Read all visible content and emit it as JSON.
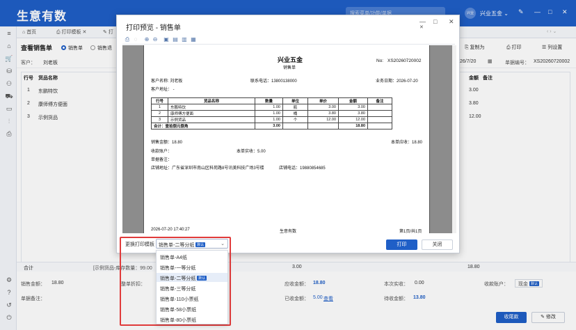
{
  "app": {
    "logo": "生意有数",
    "search_placeholder": "搜索菜单/功能/单据",
    "user_avatar": "兴业",
    "user_name": "兴业五金",
    "icons": [
      "palette-icon",
      "minimize-icon",
      "maximize-icon",
      "close-icon"
    ]
  },
  "tabs": [
    {
      "label": "首页"
    },
    {
      "label": "打印模板"
    },
    {
      "label": "打"
    }
  ],
  "page": {
    "title": "查看销售单",
    "radio1": "销售单",
    "radio2": "销售退",
    "copy_label": "复制为",
    "print_label": "打印",
    "cols_label": "列设置",
    "customer_label": "客户：",
    "customer_value": "刘老板",
    "date_value": "26/7/20",
    "bill_no_label": "单据编号：",
    "bill_no_value": "XS20260720002",
    "col_no": "行号",
    "col_name": "货品名称",
    "col_amount": "金额",
    "col_remark": "备注",
    "rows": [
      {
        "no": "1",
        "name": "东鹏特饮",
        "amount": "3.00"
      },
      {
        "no": "2",
        "name": "康师傅方便面",
        "amount": "3.80"
      },
      {
        "no": "3",
        "name": "示例货品",
        "amount": "12.00"
      }
    ],
    "sum_label": "合计",
    "sum_stock": "[示例货品-库存数量：99.00",
    "sum_qty": "3.00",
    "sum_amount": "18.80",
    "sales_amount_label": "销售金额：",
    "sales_amount_value": "18.80",
    "discount_label": "整单折扣：",
    "receivable_label": "应收金额：",
    "receivable_value": "18.80",
    "actual_label": "本次实收：",
    "actual_value": "0.00",
    "account_label": "收款账户：",
    "account_value": "现金",
    "default_tag": "默认",
    "remark_label": "单据备注：",
    "received_label": "已收金额：",
    "received_value": "5.00",
    "view_link": "查看",
    "pending_label": "待收金额：",
    "pending_value": "13.80",
    "collect_btn": "收尾款",
    "edit_btn": "修改"
  },
  "dialog": {
    "title": "打印预览 - 销售单",
    "paper": {
      "company": "兴业五金",
      "doc_type": "销售单",
      "no_label": "No:",
      "no_value": "XS20260720002",
      "customer": "客户名称: 刘老板",
      "phone": "联系电话：13800138000",
      "biz_date": "业务日期：2026-07-20",
      "address": "客户地址： -",
      "table_headers": [
        "行号",
        "货品名称",
        "数量",
        "单位",
        "单价",
        "金额",
        "备注"
      ],
      "table_rows": [
        [
          "1",
          "东鹏特饮",
          "1.00",
          "瓶",
          "3.00",
          "3.00",
          ""
        ],
        [
          "2",
          "康师傅方便面",
          "1.00",
          "桶",
          "3.80",
          "3.80",
          ""
        ],
        [
          "3",
          "示例货品",
          "1.00",
          "个",
          "12.00",
          "12.00",
          ""
        ]
      ],
      "total_label": "合计：壹拾捌元捌角",
      "total_qty": "3.00",
      "total_amount": "18.80",
      "sales_amount": "销售金额：18.80",
      "current_receivable": "本单应收：18.80",
      "account": "收款账户：",
      "actual": "本单实收：5.00",
      "remark": "单据备注：",
      "store_addr": "店铺地址：广东省深圳市南山区科苑路8号讯美科技广场3号楼",
      "store_phone": "店铺电话：19880854685",
      "print_time": "2026-07-20 17:40:27",
      "footer_brand": "生意有数",
      "page_info": "第1页/共1页"
    },
    "template_label": "更换打印模板",
    "template_selected": "销售单-二等分纸",
    "default_tag": "默认",
    "print_btn": "打印",
    "close_btn": "关闭",
    "options": [
      {
        "label": "销售单-A4纸",
        "default": ""
      },
      {
        "label": "销售单-一等分纸",
        "default": ""
      },
      {
        "label": "销售单-二等分纸",
        "default": "默认"
      },
      {
        "label": "销售单-三等分纸",
        "default": ""
      },
      {
        "label": "销售单-110小票纸",
        "default": ""
      },
      {
        "label": "销售单-58小票纸",
        "default": ""
      },
      {
        "label": "销售单-80小票纸",
        "default": ""
      }
    ]
  }
}
